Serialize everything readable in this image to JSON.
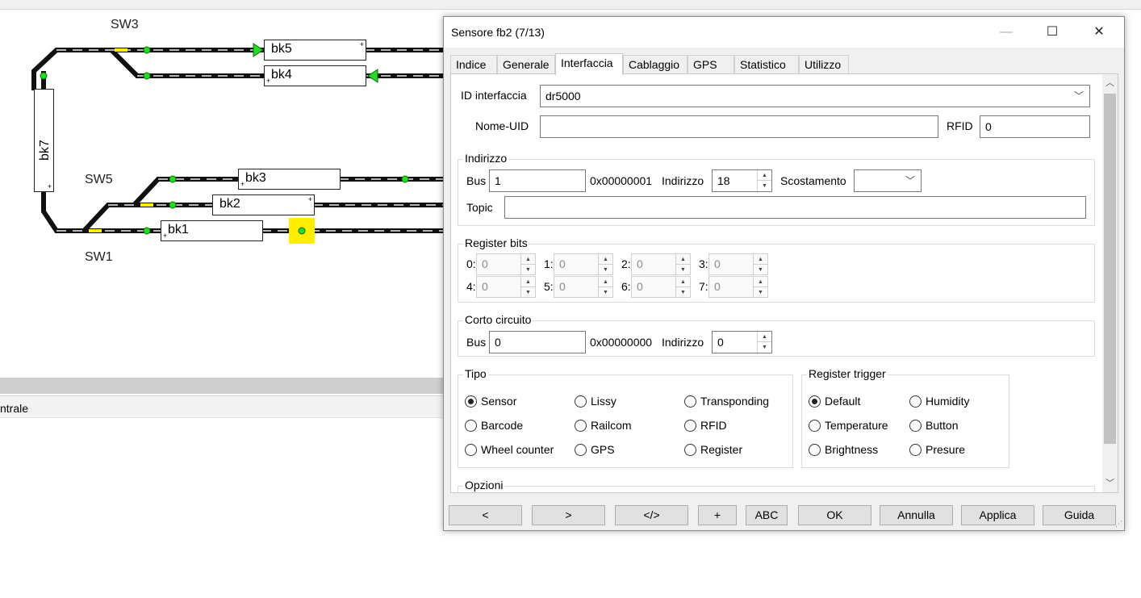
{
  "plan": {
    "labels": {
      "sw3": "SW3",
      "sw5": "SW5",
      "sw1": "SW1"
    },
    "blocks": {
      "bk5": "bk5",
      "bk4": "bk4",
      "bk3": "bk3",
      "bk2": "bk2",
      "bk1": "bk1",
      "bk7": "bk7"
    },
    "status_text": "ntrale",
    "colors": {
      "track": "#111111",
      "sleeper": "#b0b0b0",
      "sensor_green": "#22dd22",
      "occupied_yellow": "#ffee00"
    }
  },
  "dialog": {
    "title": "Sensore fb2 (7/13)",
    "controls": {
      "minimize": "—",
      "maximize": "☐",
      "close": "✕"
    },
    "tabs": [
      "Indice",
      "Generale",
      "Interfaccia",
      "Cablaggio",
      "GPS",
      "Statistico",
      "Utilizzo"
    ],
    "active_tab": "Interfaccia",
    "interface_id": {
      "label": "ID interfaccia",
      "value": "dr5000"
    },
    "uid": {
      "label": "Nome-UID",
      "value": ""
    },
    "rfid": {
      "label": "RFID",
      "value": "0"
    },
    "address_group": {
      "title": "Indirizzo",
      "bus_label": "Bus",
      "bus_value": "1",
      "bus_hex": "0x00000001",
      "address_label": "Indirizzo",
      "address_value": "18",
      "offset_label": "Scostamento",
      "offset_value": "",
      "topic_label": "Topic",
      "topic_value": ""
    },
    "register_bits": {
      "title": "Register bits",
      "bits": [
        {
          "label": "0:",
          "value": "0"
        },
        {
          "label": "1:",
          "value": "0"
        },
        {
          "label": "2:",
          "value": "0"
        },
        {
          "label": "3:",
          "value": "0"
        },
        {
          "label": "4:",
          "value": "0"
        },
        {
          "label": "5:",
          "value": "0"
        },
        {
          "label": "6:",
          "value": "0"
        },
        {
          "label": "7:",
          "value": "0"
        }
      ]
    },
    "short_circuit": {
      "title": "Corto circuito",
      "bus_label": "Bus",
      "bus_value": "0",
      "bus_hex": "0x00000000",
      "address_label": "Indirizzo",
      "address_value": "0"
    },
    "type_group": {
      "title": "Tipo",
      "options": [
        "Sensor",
        "Lissy",
        "Transponding",
        "Barcode",
        "Railcom",
        "RFID",
        "Wheel counter",
        "GPS",
        "Register"
      ],
      "selected": "Sensor"
    },
    "trigger_group": {
      "title": "Register trigger",
      "options": [
        "Default",
        "Humidity",
        "Temperature",
        "Button",
        "Brightness",
        "Presure"
      ],
      "selected": "Default"
    },
    "options_group": {
      "title": "Opzioni"
    },
    "footer": {
      "prev": "<",
      "next": ">",
      "code": "</>",
      "plus": "+",
      "abc": "ABC",
      "ok": "OK",
      "cancel": "Annulla",
      "apply": "Applica",
      "help": "Guida"
    }
  }
}
